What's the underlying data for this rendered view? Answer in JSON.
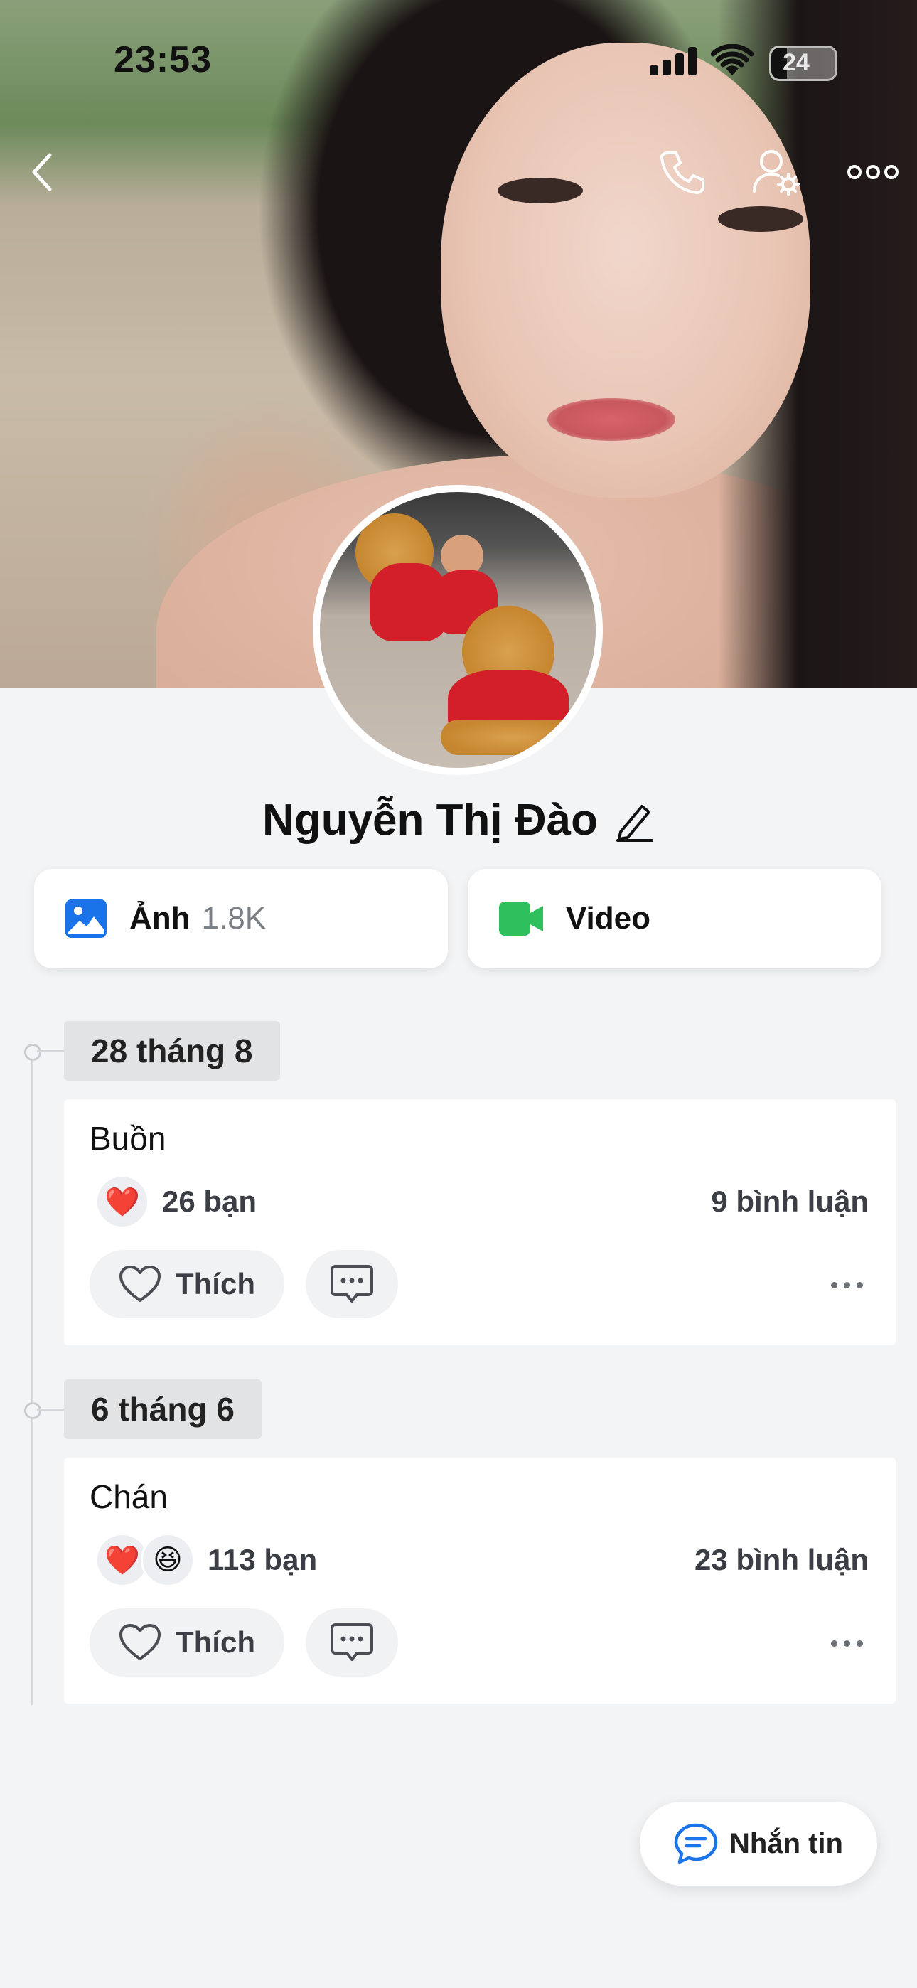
{
  "status_bar": {
    "time": "23:53",
    "battery": "24"
  },
  "profile": {
    "name": "Nguyễn Thị Đào"
  },
  "media": {
    "photos_label": "Ảnh",
    "photos_count": "1.8K",
    "video_label": "Video"
  },
  "timeline": [
    {
      "date": "28 tháng 8",
      "text": "Buồn",
      "reactions": [
        "❤️"
      ],
      "reaction_count": "26 bạn",
      "comment_count": "9 bình luận",
      "like_label": "Thích"
    },
    {
      "date": "6 tháng 6",
      "text": "Chán",
      "reactions": [
        "❤️",
        "😆"
      ],
      "reaction_count": "113 bạn",
      "comment_count": "23 bình luận",
      "like_label": "Thích"
    }
  ],
  "message_button": {
    "label": "Nhắn tin"
  },
  "colors": {
    "photo_icon": "#1a73e8",
    "video_icon": "#2fbf5c",
    "message_icon": "#1a73e8"
  }
}
